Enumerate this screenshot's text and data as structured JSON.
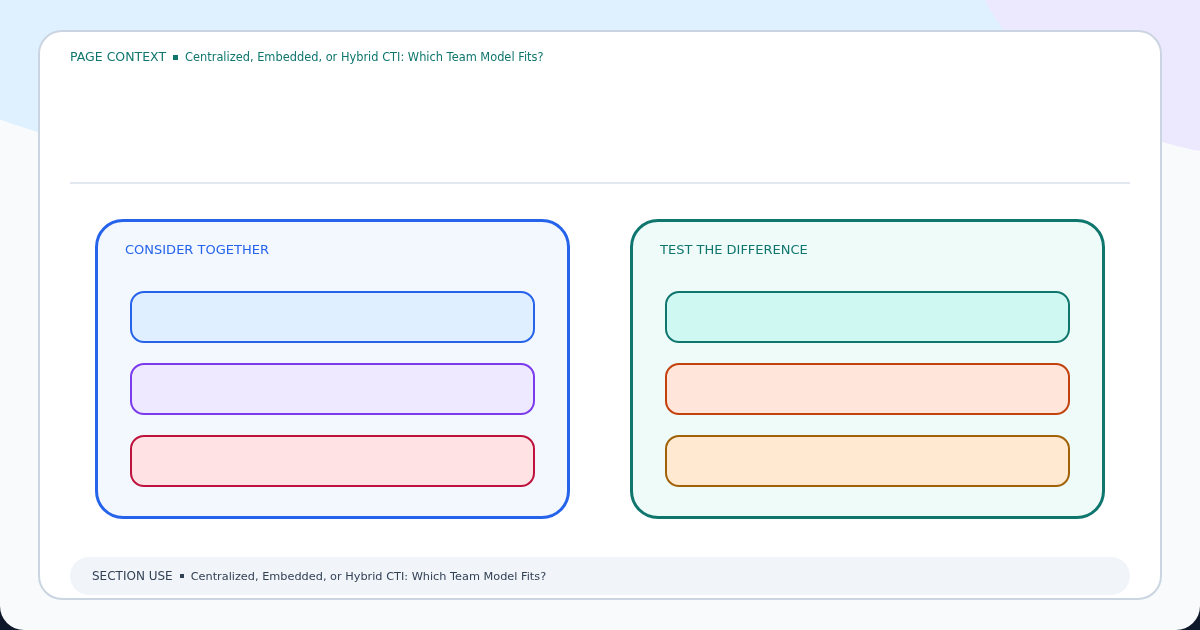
{
  "page_context": {
    "label": "PAGE CONTEXT",
    "title": "Centralized, Embedded, or Hybrid CTI: Which Team Model Fits?"
  },
  "panels": [
    {
      "title": "CONSIDER TOGETHER",
      "color": "#2563eb",
      "slots": [
        {
          "color": "#2563eb"
        },
        {
          "color": "#7c3aed"
        },
        {
          "color": "#be123c"
        }
      ]
    },
    {
      "title": "TEST THE DIFFERENCE",
      "color": "#0f766e",
      "slots": [
        {
          "color": "#0f766e"
        },
        {
          "color": "#c2410c"
        },
        {
          "color": "#a16207"
        }
      ]
    }
  ],
  "section_use": {
    "label": "SECTION USE",
    "title": "Centralized, Embedded, or Hybrid CTI: Which Team Model Fits?"
  }
}
